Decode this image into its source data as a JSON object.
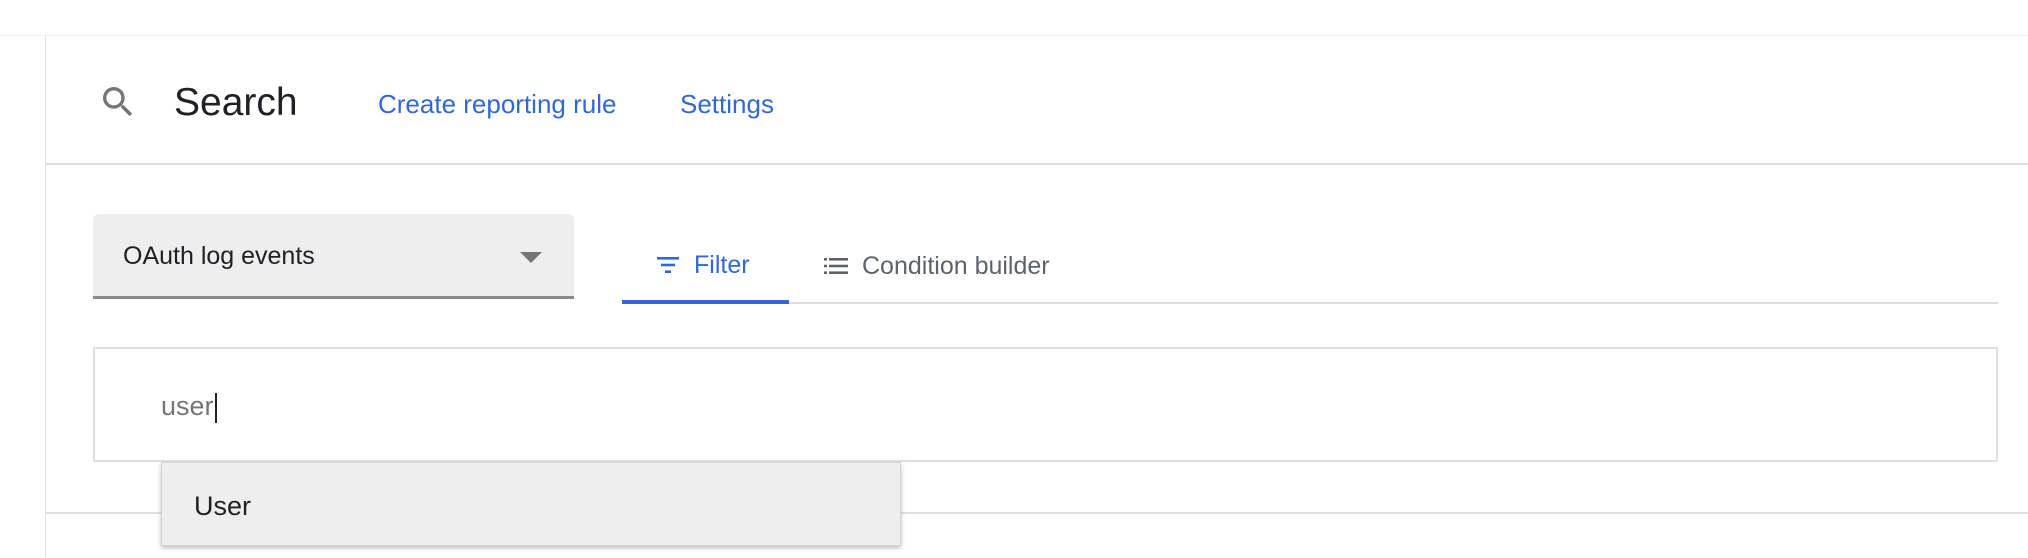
{
  "header": {
    "icon": "search-icon",
    "title": "Search",
    "links": {
      "create_rule": "Create reporting rule",
      "settings": "Settings"
    }
  },
  "source_select": {
    "selected": "OAuth log events"
  },
  "tabs": [
    {
      "label": "Filter",
      "icon": "filter-icon",
      "active": true
    },
    {
      "label": "Condition builder",
      "icon": "list-icon",
      "active": false
    }
  ],
  "query": {
    "value": "user"
  },
  "suggestions": [
    {
      "label": "User"
    }
  ],
  "colors": {
    "accent": "#3367d6",
    "select_bg": "#eeeeee",
    "border": "#e0e0e0"
  }
}
